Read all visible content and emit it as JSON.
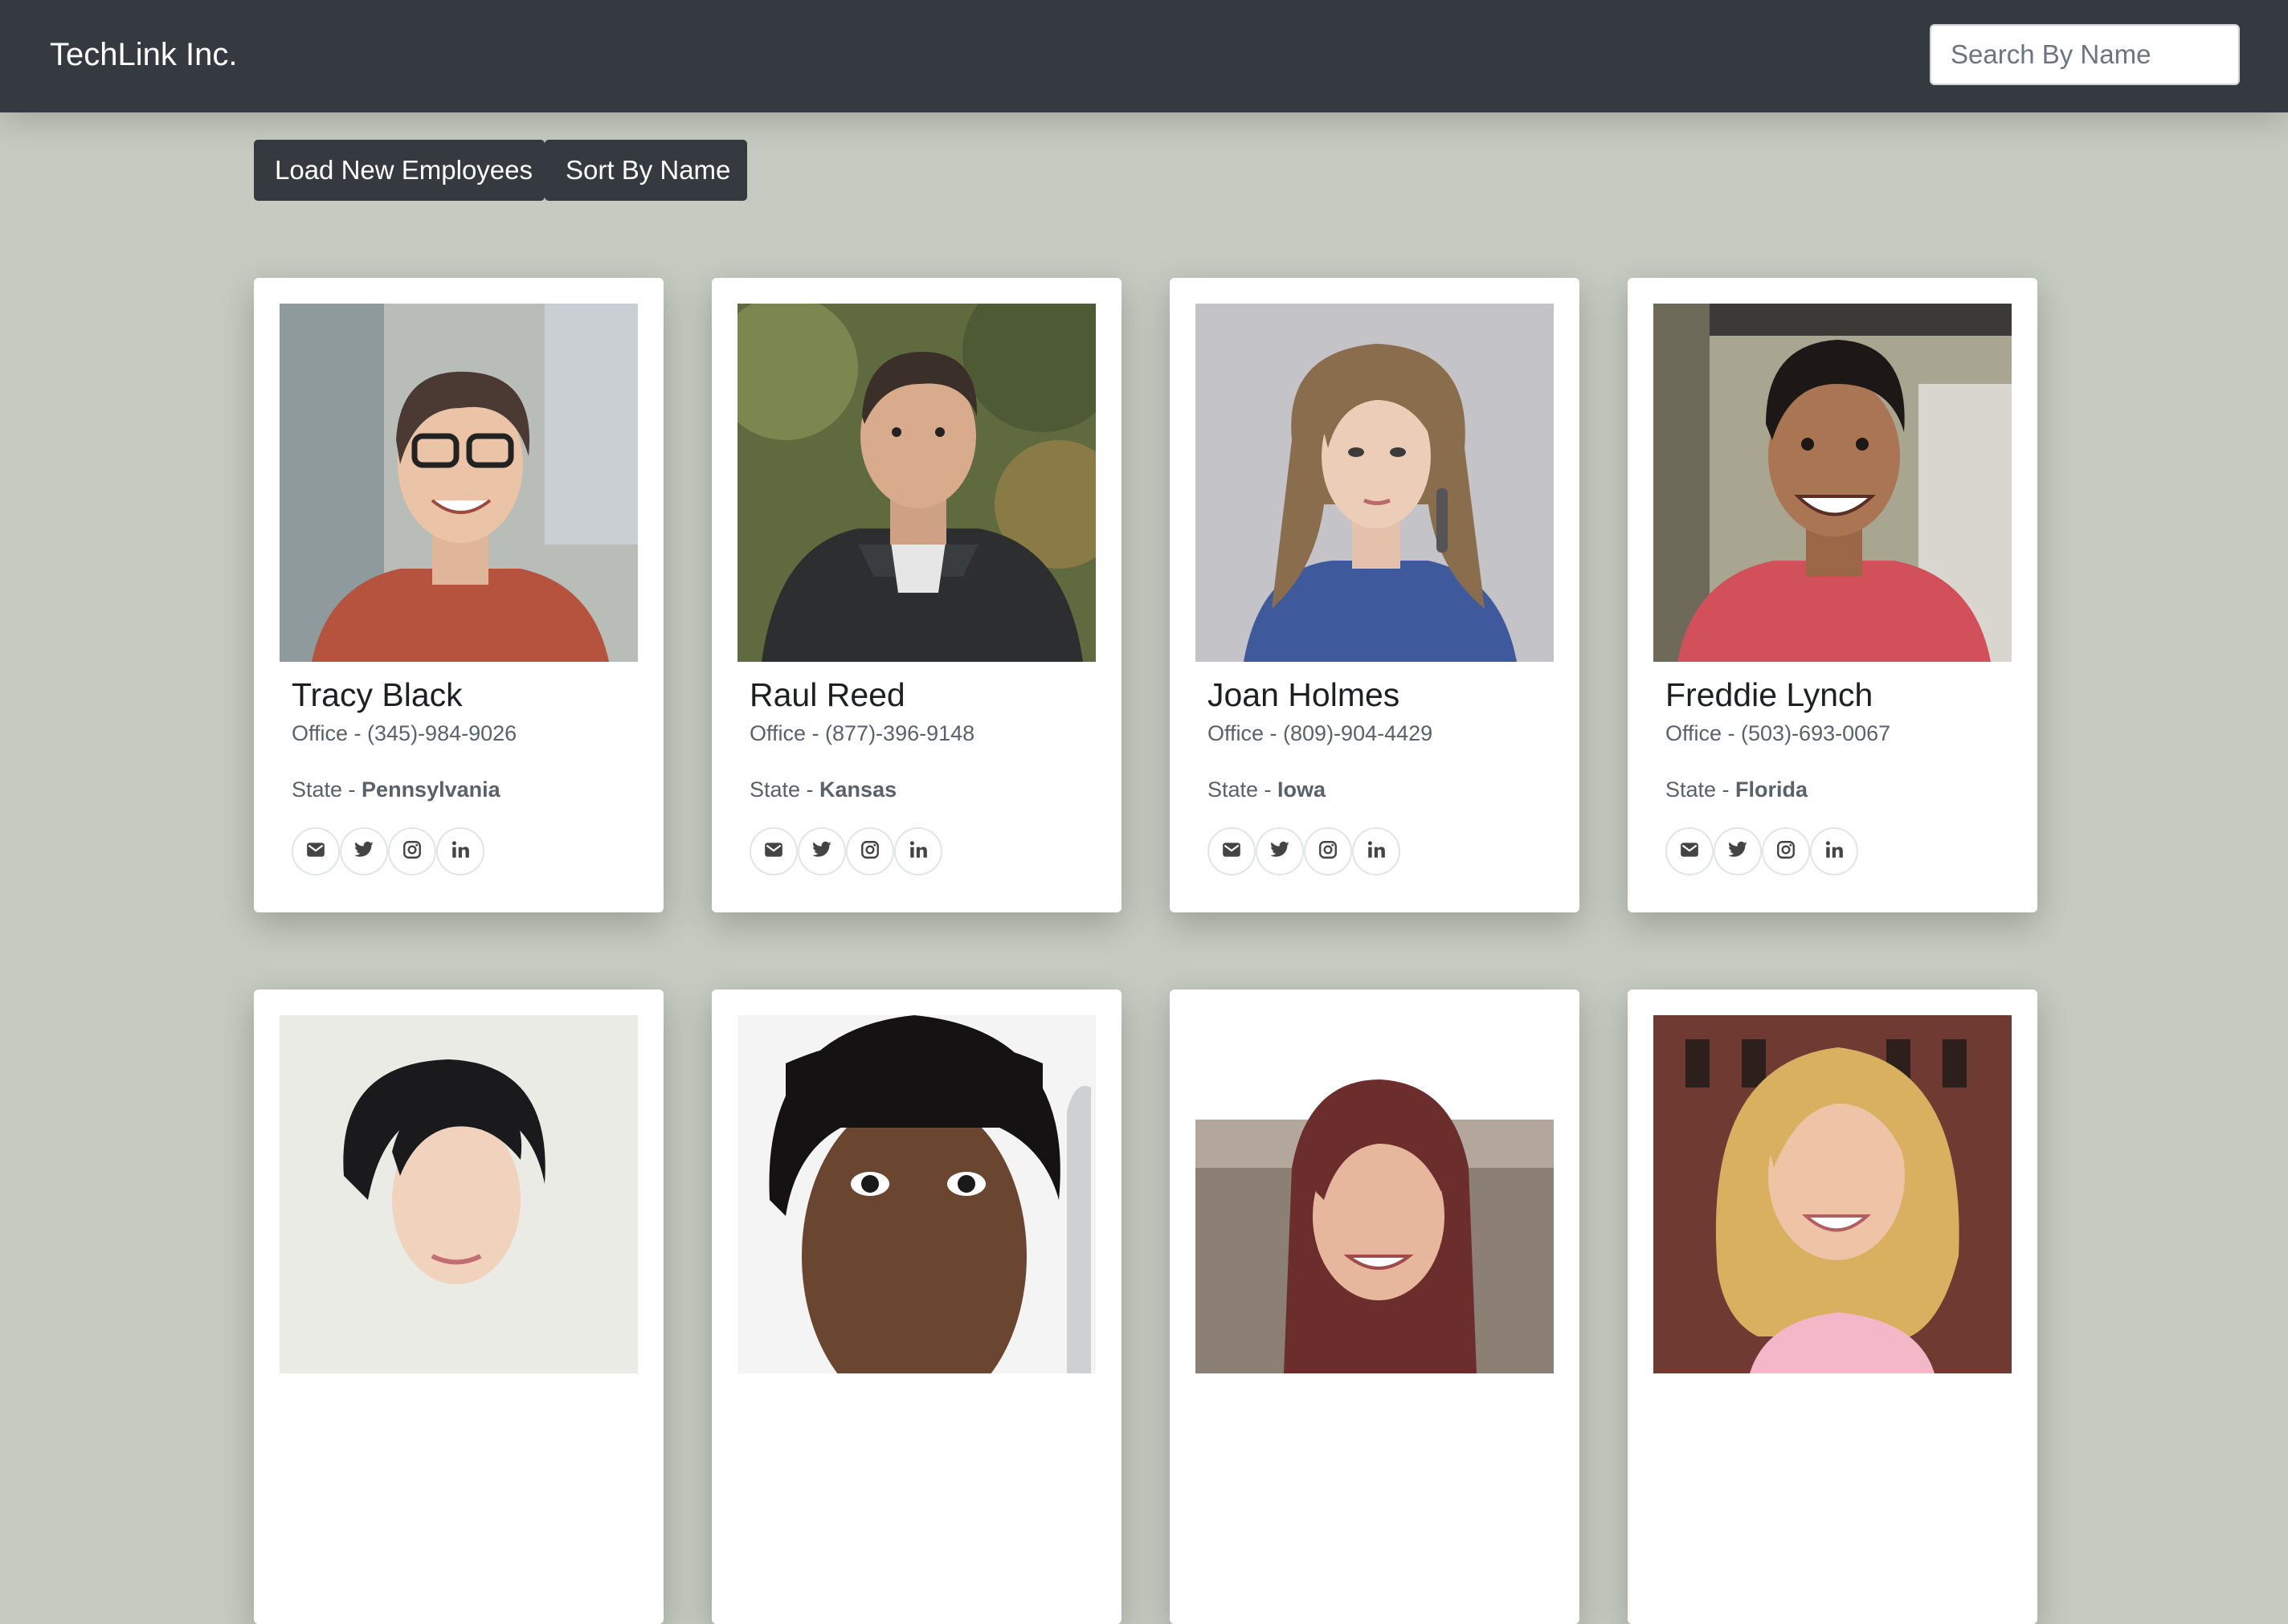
{
  "navbar": {
    "brand": "TechLink Inc.",
    "search_placeholder": "Search By Name"
  },
  "toolbar": {
    "load_label": "Load New Employees",
    "sort_label": "Sort By Name"
  },
  "employees": [
    {
      "name": "Tracy Black",
      "office": "Office - (345)-984-9026",
      "state_label": "State - ",
      "state": "Pennsylvania"
    },
    {
      "name": "Raul Reed",
      "office": "Office - (877)-396-9148",
      "state_label": "State - ",
      "state": "Kansas"
    },
    {
      "name": "Joan Holmes",
      "office": "Office - (809)-904-4429",
      "state_label": "State - ",
      "state": "Iowa"
    },
    {
      "name": "Freddie Lynch",
      "office": "Office - (503)-693-0067",
      "state_label": "State - ",
      "state": "Florida"
    },
    {
      "name": "",
      "office": "",
      "state_label": "",
      "state": ""
    },
    {
      "name": "",
      "office": "",
      "state_label": "",
      "state": ""
    },
    {
      "name": "",
      "office": "",
      "state_label": "",
      "state": ""
    },
    {
      "name": "",
      "office": "",
      "state_label": "",
      "state": ""
    }
  ],
  "social_icons": [
    "envelope-icon",
    "twitter-icon",
    "instagram-icon",
    "linkedin-icon"
  ],
  "colors": {
    "navbar": "#343a40",
    "page_background": "#c5cbc0",
    "button": "#343a40",
    "card": "#ffffff"
  }
}
